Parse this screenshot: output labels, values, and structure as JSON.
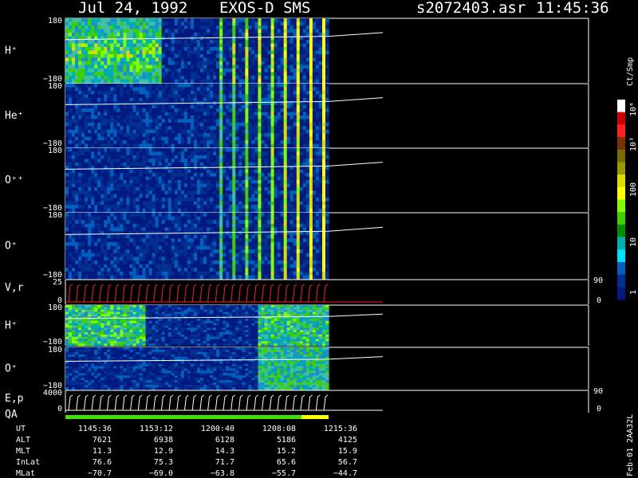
{
  "header": {
    "date": "Jul 24, 1992",
    "instrument": "EXOS-D SMS",
    "file": "s2072403.asr",
    "time": "11:45:36"
  },
  "colorbar": {
    "unit": "Ct/Smp",
    "ticks": [
      "10⁴",
      "10³",
      "100",
      "10",
      "1"
    ],
    "colors": [
      "#ffffff",
      "#cc0000",
      "#ff2020",
      "#7a3000",
      "#7a6a00",
      "#999900",
      "#dddd00",
      "#ffff00",
      "#7fff00",
      "#40d000",
      "#009000",
      "#00b0b0",
      "#00e0ff",
      "#0060c0",
      "#003090",
      "#001a80"
    ]
  },
  "footer_id": "Feb-01 2AA32L",
  "chart_data": [
    {
      "type": "heatmap",
      "name_label": "H⁺",
      "ylabel_top": "180",
      "ylabel_bottom": "−180",
      "ylim": [
        -180,
        180
      ],
      "brightness": 0.8
    },
    {
      "type": "heatmap",
      "name_label": "He⁺",
      "ylabel_top": "180",
      "ylabel_bottom": "−180",
      "ylim": [
        -180,
        180
      ],
      "brightness": 0.35
    },
    {
      "type": "heatmap",
      "name_label": "O⁺⁺",
      "ylabel_top": "180",
      "ylabel_bottom": "−180",
      "ylim": [
        -180,
        180
      ],
      "brightness": 0.3
    },
    {
      "type": "heatmap",
      "name_label": "O⁺",
      "ylabel_top": "180",
      "ylabel_bottom": "−180",
      "ylim": [
        -180,
        180
      ],
      "brightness": 0.35
    },
    {
      "type": "line",
      "name_label": "V,r",
      "ylabel_top": "25",
      "ylabel_bottom": "0",
      "right_top": "90",
      "right_bottom": "0",
      "ylim": [
        0,
        25
      ]
    },
    {
      "type": "heatmap",
      "name_label": "H⁺",
      "ylabel_top": "180",
      "ylabel_bottom": "−180",
      "ylim": [
        -180,
        180
      ],
      "brightness": 0.7
    },
    {
      "type": "heatmap",
      "name_label": "O⁺",
      "ylabel_top": "180",
      "ylabel_bottom": "−180",
      "ylim": [
        -180,
        180
      ],
      "brightness": 0.5
    },
    {
      "type": "line",
      "name_label": "E,p",
      "ylabel_top": "4000",
      "ylabel_bottom": "0",
      "right_top": "90",
      "right_bottom": "0",
      "ylim": [
        0,
        4000
      ]
    }
  ],
  "qa_label": "QA",
  "ephemeris": {
    "labels": [
      "UT",
      "ALT",
      "MLT",
      "InLat",
      "MLat"
    ],
    "columns": [
      [
        "1145:36",
        "7621",
        "11.3",
        "76.6",
        "−70.7"
      ],
      [
        "1153:12",
        "6938",
        "12.9",
        "75.3",
        "−69.0"
      ],
      [
        "1200:40",
        "6128",
        "14.3",
        "71.7",
        "−63.8"
      ],
      [
        "1208:08",
        "5186",
        "15.2",
        "65.6",
        "−55.7"
      ],
      [
        "1215:36",
        "4125",
        "15.9",
        "56.7",
        "−44.7"
      ]
    ]
  }
}
